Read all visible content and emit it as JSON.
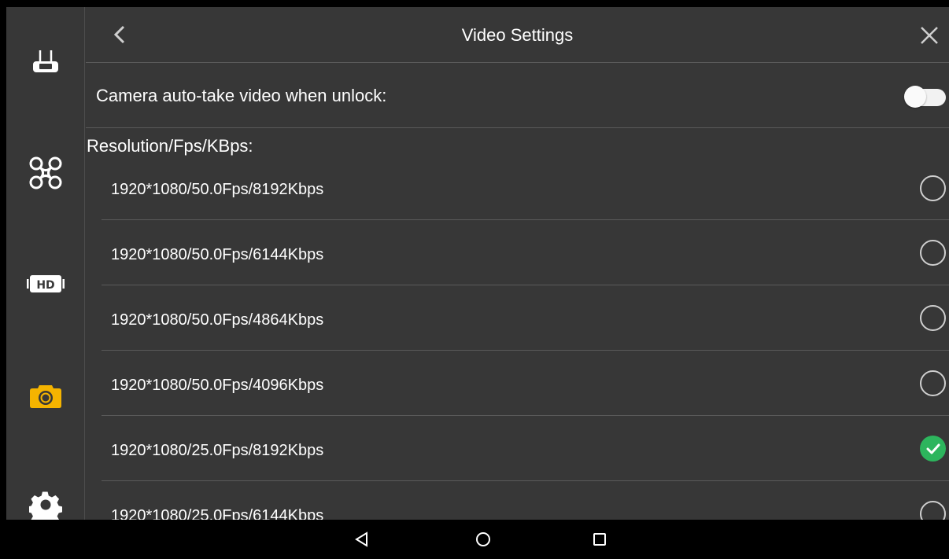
{
  "header": {
    "title": "Video Settings"
  },
  "sidebar": {
    "items": [
      {
        "name": "remote-controller"
      },
      {
        "name": "aircraft"
      },
      {
        "name": "hd-transmission"
      },
      {
        "name": "camera",
        "active": true,
        "color": "#f5b400"
      },
      {
        "name": "settings"
      }
    ]
  },
  "auto_take": {
    "label": "Camera auto-take video when unlock:",
    "enabled": false
  },
  "resolution": {
    "label": "Resolution/Fps/KBps:",
    "options": [
      {
        "label": "1920*1080/50.0Fps/8192Kbps",
        "selected": false
      },
      {
        "label": "1920*1080/50.0Fps/6144Kbps",
        "selected": false
      },
      {
        "label": "1920*1080/50.0Fps/4864Kbps",
        "selected": false
      },
      {
        "label": "1920*1080/50.0Fps/4096Kbps",
        "selected": false
      },
      {
        "label": "1920*1080/25.0Fps/8192Kbps",
        "selected": true
      },
      {
        "label": "1920*1080/25.0Fps/6144Kbps",
        "selected": false
      }
    ]
  },
  "colors": {
    "background": "#373737",
    "selected": "#2db55d",
    "active_icon": "#f5b400"
  }
}
